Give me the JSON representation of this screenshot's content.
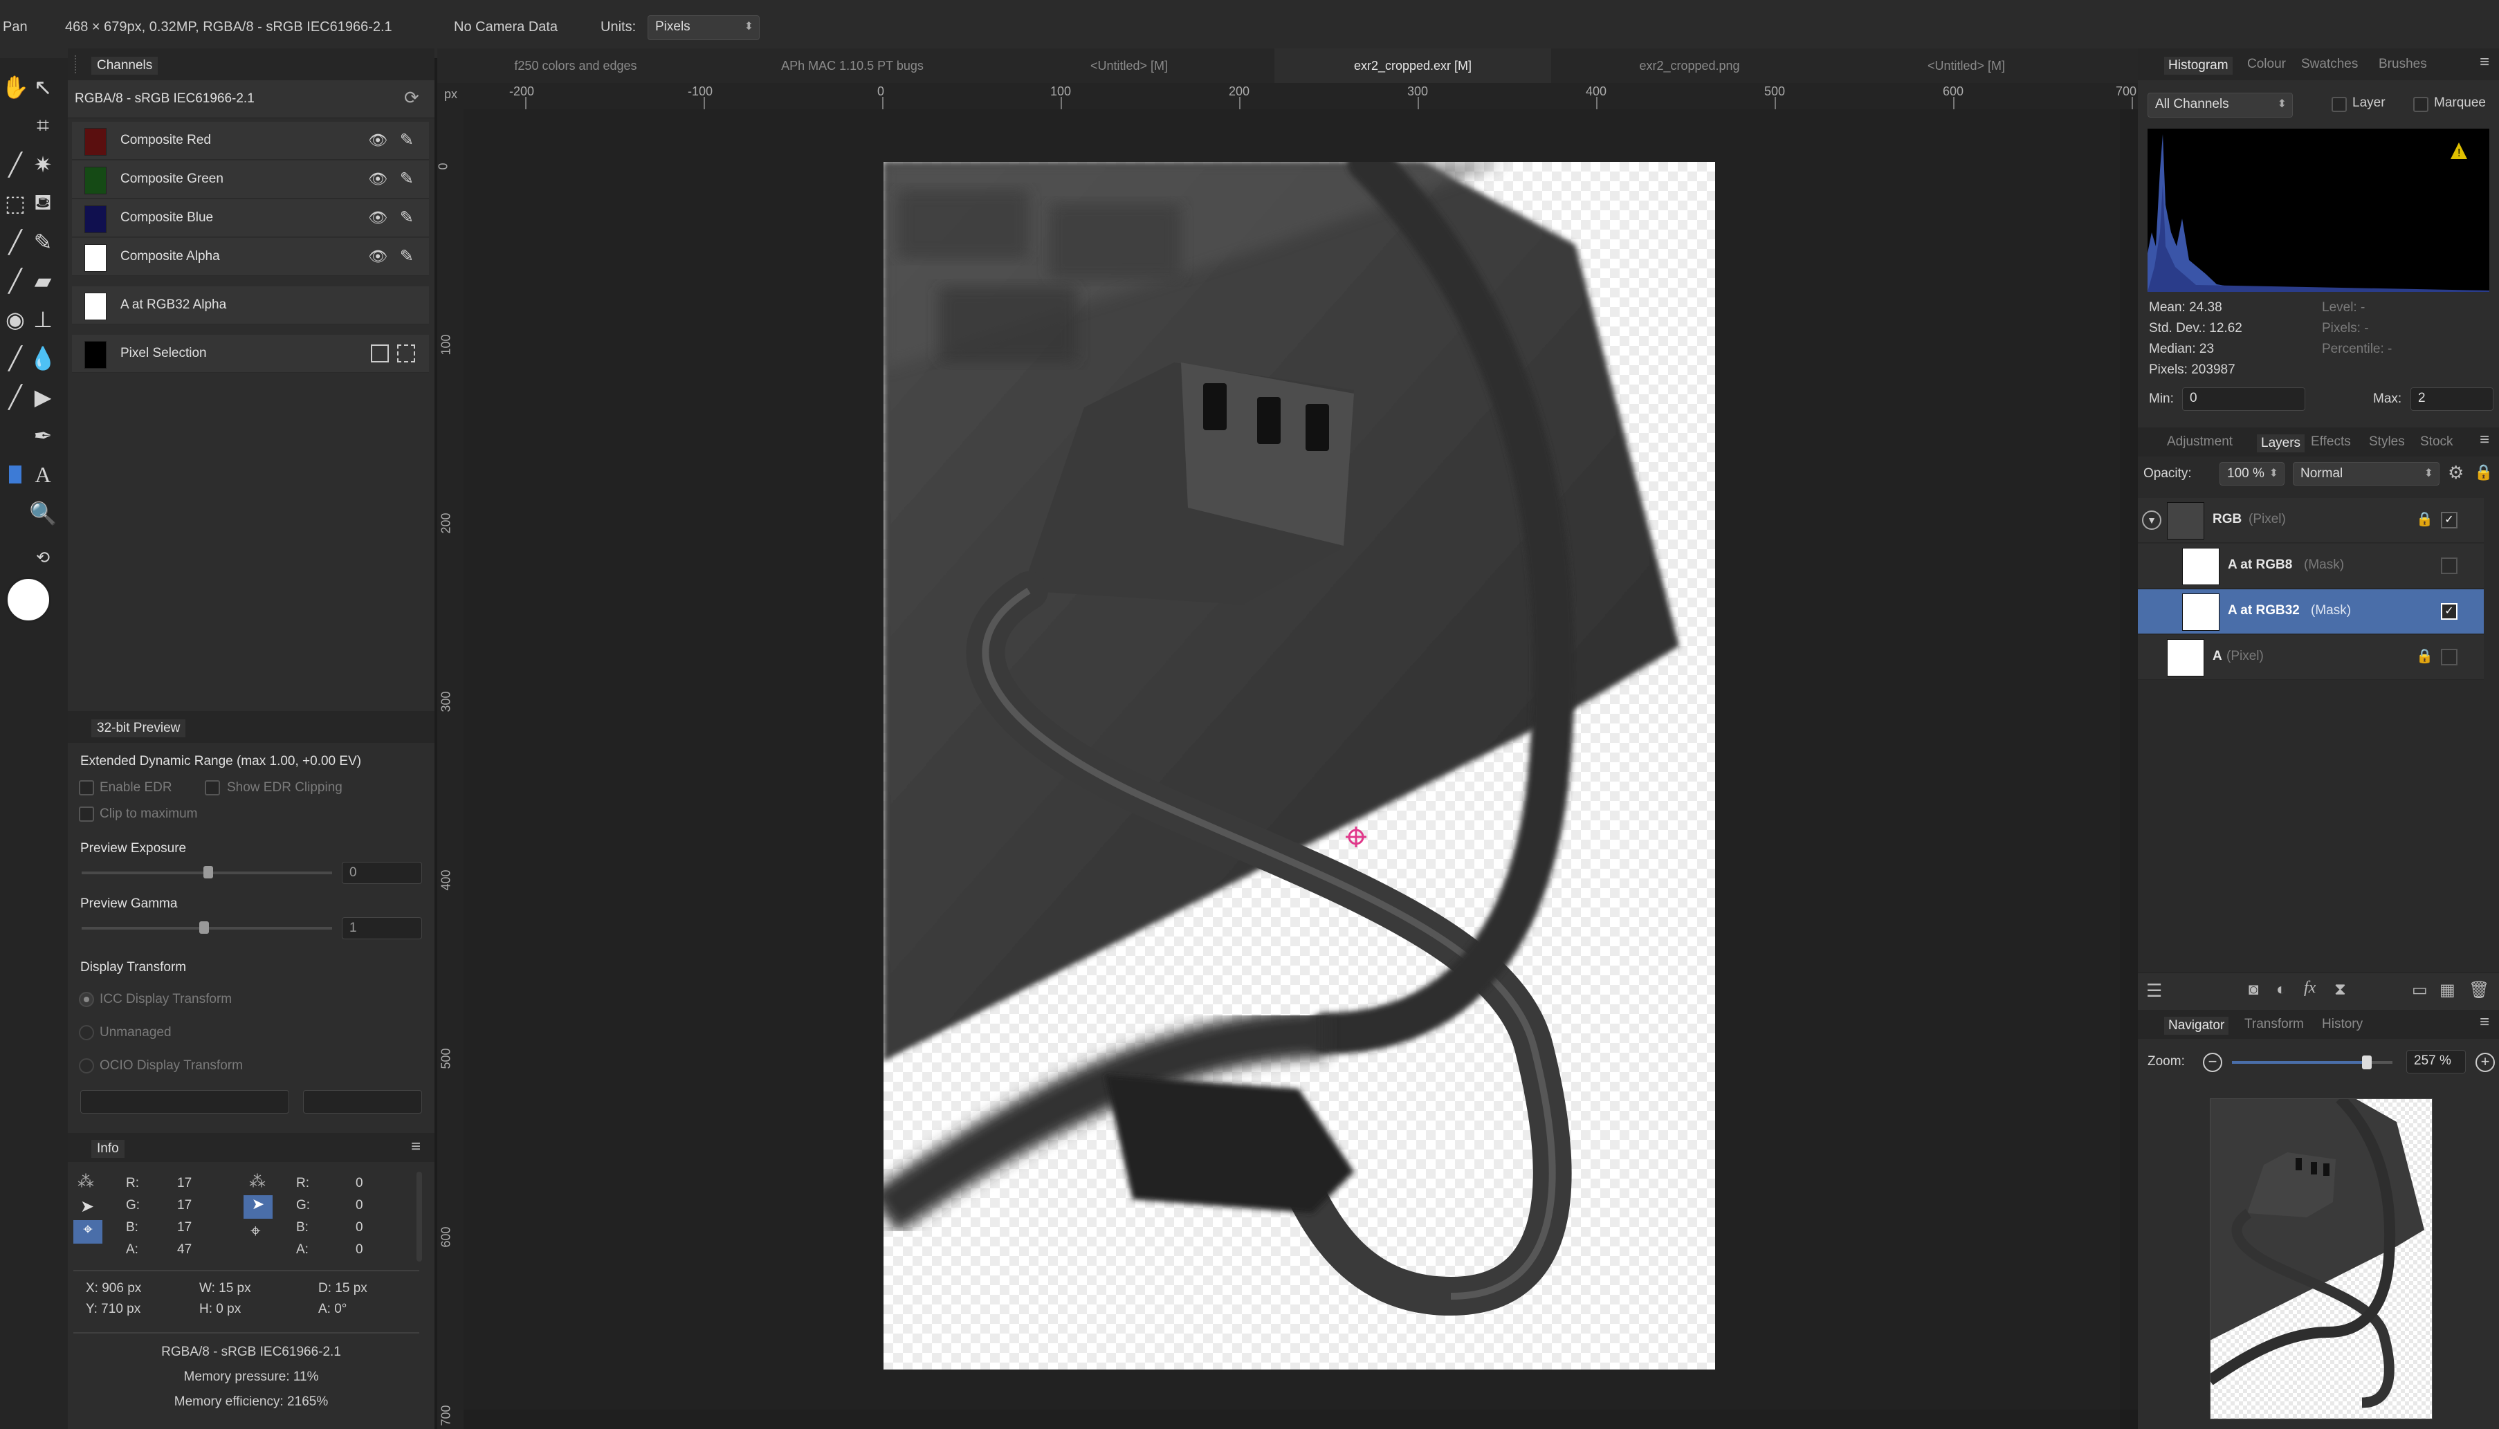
{
  "topbar": {
    "tool": "Pan",
    "doc_info": "468 × 679px, 0.32MP, RGBA/8 - sRGB IEC61966-2.1",
    "camera": "No Camera Data",
    "units_label": "Units:",
    "units_value": "Pixels"
  },
  "doc_tabs": [
    {
      "label": "f250 colors and edges"
    },
    {
      "label": "APh MAC 1.10.5 PT bugs"
    },
    {
      "label": "<Untitled> [M]"
    },
    {
      "label": "exr2_cropped.exr [M]"
    },
    {
      "label": "exr2_cropped.png"
    },
    {
      "label": "<Untitled> [M]"
    }
  ],
  "channels": {
    "tab": "Channels",
    "profile": "RGBA/8 - sRGB IEC61966-2.1",
    "items": [
      {
        "label": "Composite Red",
        "color": "#8b1a1a"
      },
      {
        "label": "Composite Green",
        "color": "#1f6b1f"
      },
      {
        "label": "Composite Blue",
        "color": "#1a1a7a"
      },
      {
        "label": "Composite Alpha",
        "color": "#ffffff"
      }
    ],
    "mask_item": "A at RGB32 Alpha",
    "pixel_selection": "Pixel Selection"
  },
  "preview32": {
    "tab": "32-bit Preview",
    "edr_title": "Extended Dynamic Range (max 1.00, +0.00 EV)",
    "enable_edr": "Enable EDR",
    "show_edr_clipping": "Show EDR Clipping",
    "clip_to_max": "Clip to maximum",
    "exposure_label": "Preview Exposure",
    "exposure_value": "0",
    "gamma_label": "Preview Gamma",
    "gamma_value": "1",
    "display_transform": "Display Transform",
    "icc": "ICC Display Transform",
    "unmanaged": "Unmanaged",
    "ocio": "OCIO Display Transform"
  },
  "info": {
    "tab": "Info",
    "left": {
      "r_label": "R:",
      "r": "17",
      "g_label": "G:",
      "g": "17",
      "b_label": "B:",
      "b": "17",
      "a_label": "A:",
      "a": "47"
    },
    "right": {
      "r_label": "R:",
      "r": "0",
      "g_label": "G:",
      "g": "0",
      "b_label": "B:",
      "b": "0",
      "a_label": "A:",
      "a": "0"
    },
    "x": "X: 906 px",
    "y": "Y: 710 px",
    "w": "W: 15 px",
    "h": "H: 0 px",
    "d": "D: 15 px",
    "angle": "A: 0°",
    "profile": "RGBA/8 - sRGB IEC61966-2.1",
    "mem_pressure": "Memory pressure: 11%",
    "mem_efficiency": "Memory efficiency: 2165%"
  },
  "ruler": {
    "unit": "px",
    "h_ticks": [
      "-200",
      "-100",
      "0",
      "100",
      "200",
      "300",
      "400",
      "500",
      "600",
      "700"
    ],
    "v_ticks": [
      "0",
      "100",
      "200",
      "300",
      "400",
      "500",
      "600",
      "700"
    ]
  },
  "histogram": {
    "tabs": [
      "Histogram",
      "Colour",
      "Swatches",
      "Brushes"
    ],
    "channel": "All Channels",
    "layer": "Layer",
    "marquee": "Marquee",
    "mean": "Mean: 24.38",
    "std": "Std. Dev.: 12.62",
    "median": "Median: 23",
    "pixels": "Pixels: 203987",
    "level": "Level: -",
    "pixels_r": "Pixels: -",
    "percentile": "Percentile: -",
    "min_label": "Min:",
    "min": "0",
    "max_label": "Max:",
    "max": "2"
  },
  "layers": {
    "tabs": [
      "Adjustment",
      "Layers",
      "Effects",
      "Styles",
      "Stock"
    ],
    "opacity_label": "Opacity:",
    "opacity": "100 %",
    "blend": "Normal",
    "items": [
      {
        "name": "RGB",
        "type": "(Pixel)"
      },
      {
        "name": "A at RGB8",
        "type": "(Mask)"
      },
      {
        "name": "A at RGB32",
        "type": "(Mask)"
      },
      {
        "name": "A",
        "type": "(Pixel)"
      }
    ]
  },
  "navigator": {
    "tabs": [
      "Navigator",
      "Transform",
      "History"
    ],
    "zoom_label": "Zoom:",
    "zoom": "257 %",
    "zoom_fraction": 0.84
  },
  "colors": {
    "accent": "#4a6ea9",
    "cursor": "#e0388a",
    "warning": "#e0c000"
  }
}
